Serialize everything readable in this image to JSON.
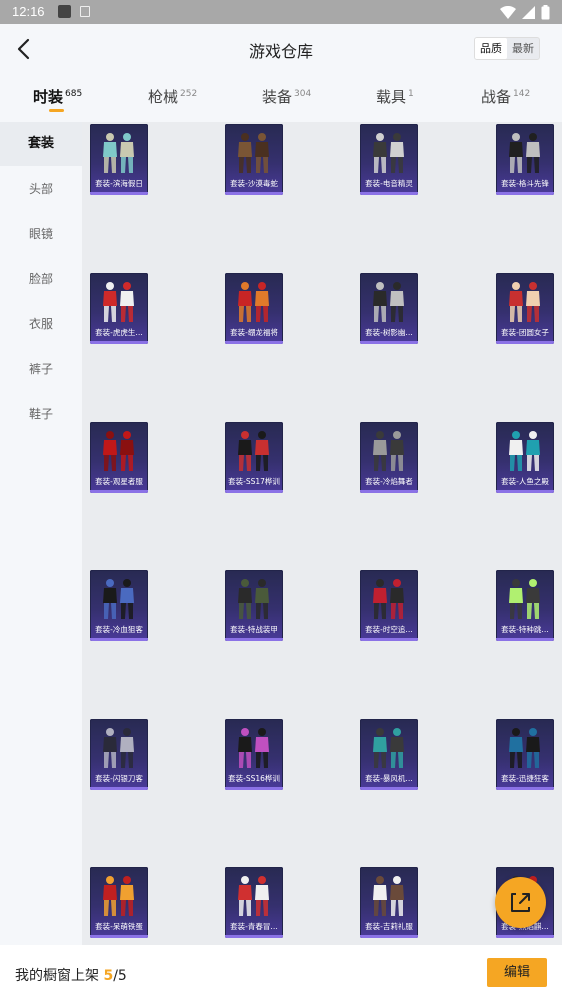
{
  "status_bar": {
    "time": "12:16"
  },
  "header": {
    "title": "游戏仓库",
    "sort_options": [
      "品质",
      "最新"
    ],
    "sort_selected": "品质"
  },
  "tabs": [
    {
      "label": "时装",
      "count": "685",
      "active": true
    },
    {
      "label": "枪械",
      "count": "252",
      "active": false
    },
    {
      "label": "装备",
      "count": "304",
      "active": false
    },
    {
      "label": "载具",
      "count": "1",
      "active": false
    },
    {
      "label": "战备",
      "count": "142",
      "active": false
    }
  ],
  "sidebar": {
    "items": [
      {
        "label": "套装",
        "active": true
      },
      {
        "label": "头部",
        "active": false
      },
      {
        "label": "眼镜",
        "active": false
      },
      {
        "label": "脸部",
        "active": false
      },
      {
        "label": "衣服",
        "active": false
      },
      {
        "label": "裤子",
        "active": false
      },
      {
        "label": "鞋子",
        "active": false
      }
    ]
  },
  "items": [
    {
      "name": "套装-滨海假日",
      "palette": [
        "#7fc9c9",
        "#c9c9b0"
      ]
    },
    {
      "name": "套装-沙漠毒蛇",
      "palette": [
        "#7a5535",
        "#4a3020"
      ]
    },
    {
      "name": "套装-电音精灵",
      "palette": [
        "#3a3a3a",
        "#d0d0d0"
      ]
    },
    {
      "name": "套装-格斗先锋",
      "palette": [
        "#202020",
        "#bfbfbf"
      ]
    },
    {
      "name": "套装-虎虎生…",
      "palette": [
        "#d02a2a",
        "#f0f0f0"
      ]
    },
    {
      "name": "套装-绷龙福将",
      "palette": [
        "#c82525",
        "#e07a2a"
      ]
    },
    {
      "name": "套装-树影幽…",
      "palette": [
        "#2a2a2a",
        "#c0c0c0"
      ]
    },
    {
      "name": "套装-团圆女子",
      "palette": [
        "#c83030",
        "#f0d0b0"
      ]
    },
    {
      "name": "套装-观星者服",
      "palette": [
        "#c01818",
        "#8a1010"
      ]
    },
    {
      "name": "套装-SS17桦训",
      "palette": [
        "#1a1a1a",
        "#c83030"
      ]
    },
    {
      "name": "套装-冷焰舞者",
      "palette": [
        "#9a9a9a",
        "#3a3a3a"
      ]
    },
    {
      "name": "套装-人鱼之殿",
      "palette": [
        "#f0f0f0",
        "#20a0b0"
      ]
    },
    {
      "name": "套装-冷血狙客",
      "palette": [
        "#1a1a1a",
        "#4a6ac0"
      ]
    },
    {
      "name": "套装-特战装甲",
      "palette": [
        "#2a2a2a",
        "#4a5a3a"
      ]
    },
    {
      "name": "套装-时空追…",
      "palette": [
        "#c02030",
        "#2a2a2a"
      ]
    },
    {
      "name": "套装-特种跳…",
      "palette": [
        "#b0f070",
        "#3a3a3a"
      ]
    },
    {
      "name": "套装-闪银刀客",
      "palette": [
        "#2a2a3a",
        "#b0b0c0"
      ]
    },
    {
      "name": "套装-SS16桦训",
      "palette": [
        "#1a1a1a",
        "#c050c0"
      ]
    },
    {
      "name": "套装-暴风机…",
      "palette": [
        "#30a0a0",
        "#3a3a3a"
      ]
    },
    {
      "name": "套装-迅捷狂客",
      "palette": [
        "#2070a0",
        "#1a1a1a"
      ]
    },
    {
      "name": "套装-呆萌铁蛋",
      "palette": [
        "#c02020",
        "#f0a030"
      ]
    },
    {
      "name": "套装-青春冒…",
      "palette": [
        "#d03030",
        "#f0f0f0"
      ]
    },
    {
      "name": "套装-吉莉礼服",
      "palette": [
        "#f0f0f0",
        "#6a4a3a"
      ]
    },
    {
      "name": "套装-烈焰麒…",
      "palette": [
        "#c02020",
        "#2a2a2a"
      ]
    }
  ],
  "footer": {
    "label": "我的橱窗上架",
    "current": "5",
    "separator": "/",
    "max": "5",
    "edit_label": "编辑"
  },
  "colors": {
    "accent": "#f5a623",
    "item_bg": "#35306e",
    "item_bar": "#8b72e6"
  }
}
